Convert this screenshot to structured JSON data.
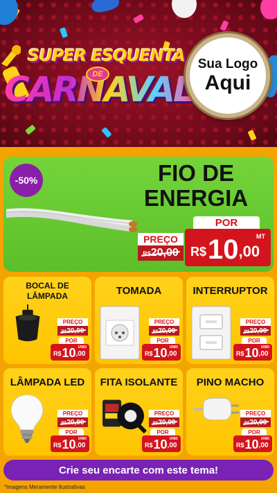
{
  "banner": {
    "title_top": "SUPER ESQUENTA",
    "title_de": "DE",
    "title_main": "CARNAVAL",
    "logo_line1": "Sua Logo",
    "logo_line2": "Aqui"
  },
  "hero": {
    "discount": "-50%",
    "title": "FIO DE ENERGIA",
    "por": "POR",
    "preco": "PREÇO",
    "old_currency": "R$",
    "old_price": "20,00",
    "currency": "R$",
    "price_int": "10",
    "price_dec": ",00",
    "unit": "MT"
  },
  "products": [
    {
      "title": "BOCAL DE LÂMPADA",
      "unit": "UNID",
      "icon": "lamp-socket-icon"
    },
    {
      "title": "TOMADA",
      "unit": "UNID",
      "icon": "wall-outlet-icon"
    },
    {
      "title": "INTERRUPTOR",
      "unit": "UNID",
      "icon": "light-switch-icon"
    },
    {
      "title": "LÂMPADA LED",
      "unit": "UNID",
      "icon": "led-bulb-icon"
    },
    {
      "title": "FITA ISOLANTE",
      "unit": "UNID",
      "icon": "insulating-tape-icon"
    },
    {
      "title": "PINO MACHO",
      "unit": "UNID",
      "icon": "plug-icon"
    }
  ],
  "card_price": {
    "preco": "PREÇO",
    "old_currency": "R$",
    "old_price": "20,00",
    "por": "POR",
    "currency": "R$",
    "price_int": "10",
    "price_dec": ",00"
  },
  "footer": {
    "cta": "Crie seu encarte com este tema!",
    "disclaimer": "*Imagens Meramente Ilustrativas"
  },
  "colors": {
    "hero_green": "#5cbf2a",
    "card_yellow": "#ffc400",
    "price_red": "#d4141c",
    "cta_purple": "#7a22b5",
    "page_orange": "#f4a400"
  }
}
